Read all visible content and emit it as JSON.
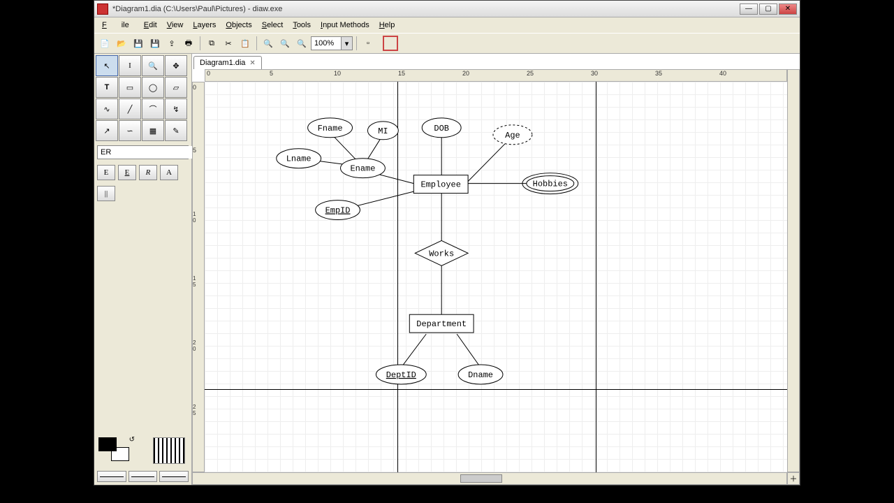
{
  "window": {
    "title": "*Diagram1.dia (C:\\Users\\Paul\\Pictures) - diaw.exe"
  },
  "menus": {
    "file": "File",
    "edit": "Edit",
    "view": "View",
    "layers": "Layers",
    "objects": "Objects",
    "select": "Select",
    "tools": "Tools",
    "input_methods": "Input Methods",
    "help": "Help"
  },
  "toolbar": {
    "zoom_value": "100%"
  },
  "toolbox": {
    "shape_set": "ER",
    "shape_btn_entity": "E",
    "shape_btn_weak_entity": "E",
    "shape_btn_relationship": "R",
    "shape_btn_attribute": "A",
    "shape_btn_participation": "||"
  },
  "tab": {
    "label": "Diagram1.dia"
  },
  "ruler": {
    "h": [
      "0",
      "5",
      "10",
      "15",
      "20",
      "25",
      "30",
      "35",
      "40"
    ],
    "v": [
      "0",
      "5",
      "10",
      "15",
      "20",
      "25"
    ]
  },
  "erd": {
    "entities": {
      "employee": "Employee",
      "department": "Department"
    },
    "relationships": {
      "works": "Works"
    },
    "attributes": {
      "fname": "Fname",
      "mi": "MI",
      "lname": "Lname",
      "ename": "Ename",
      "empid": "EmpID",
      "dob": "DOB",
      "age": "Age",
      "hobbies": "Hobbies",
      "deptid": "DeptID",
      "dname": "Dname"
    }
  }
}
